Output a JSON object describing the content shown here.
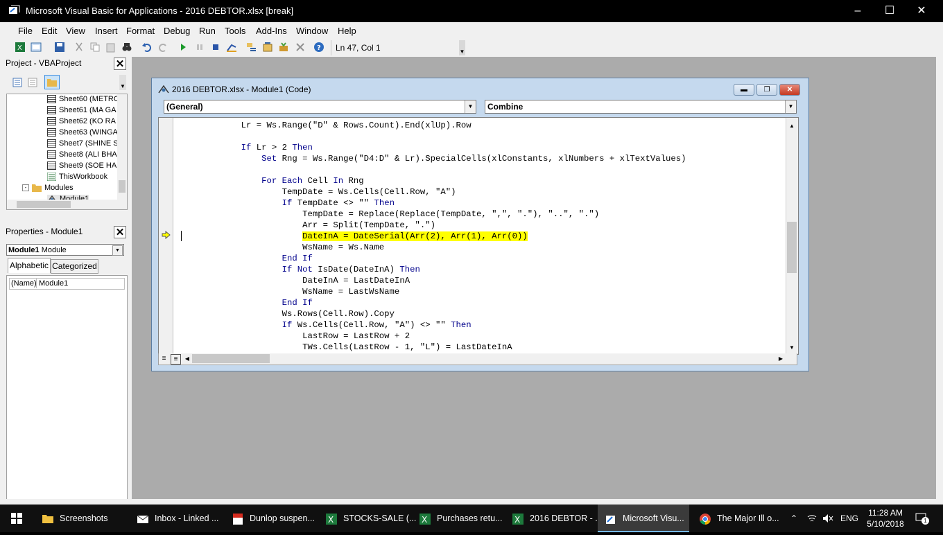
{
  "window": {
    "title": "Microsoft Visual Basic for Applications - 2016 DEBTOR.xlsx [break]"
  },
  "menu": [
    "File",
    "Edit",
    "View",
    "Insert",
    "Format",
    "Debug",
    "Run",
    "Tools",
    "Add-Ins",
    "Window",
    "Help"
  ],
  "toolbar": {
    "position": "Ln 47, Col 1"
  },
  "project": {
    "title": "Project - VBAProject",
    "items": [
      "Sheet60 (METRO",
      "Sheet61 (MA GA",
      "Sheet62 (KO RA",
      "Sheet63 (WINGA",
      "Sheet7 (SHINE S",
      "Sheet8 (ALI BHA",
      "Sheet9 (SOE HA",
      "ThisWorkbook"
    ],
    "modules_folder": "Modules",
    "module": "Module1"
  },
  "properties": {
    "title": "Properties - Module1",
    "object_name": "Module1",
    "object_type": "Module",
    "tab_alpha": "Alphabetic",
    "tab_cat": "Categorized",
    "prop_name": "(Name)",
    "prop_value": "Module1"
  },
  "code_window": {
    "title": "2016 DEBTOR.xlsx - Module1 (Code)",
    "object_combo": "(General)",
    "proc_combo": "Combine"
  },
  "code": [
    {
      "indent": "            ",
      "parts": [
        [
          "",
          "Lr = Ws.Range(\"D\" & Rows.Count).End(xlUp).Row"
        ]
      ]
    },
    {
      "indent": "",
      "parts": []
    },
    {
      "indent": "            ",
      "parts": [
        [
          "kw",
          "If"
        ],
        [
          "",
          " Lr > 2 "
        ],
        [
          "kw",
          "Then"
        ]
      ]
    },
    {
      "indent": "                ",
      "parts": [
        [
          "kw",
          "Set"
        ],
        [
          "",
          " Rng = Ws.Range(\"D4:D\" & Lr).SpecialCells(xlConstants, xlNumbers + xlTextValues)"
        ]
      ]
    },
    {
      "indent": "",
      "parts": []
    },
    {
      "indent": "                ",
      "parts": [
        [
          "kw",
          "For Each"
        ],
        [
          "",
          " Cell "
        ],
        [
          "kw",
          "In"
        ],
        [
          "",
          " Rng"
        ]
      ]
    },
    {
      "indent": "                    ",
      "parts": [
        [
          "",
          "TempDate = Ws.Cells(Cell.Row, \"A\")"
        ]
      ]
    },
    {
      "indent": "                    ",
      "parts": [
        [
          "kw",
          "If"
        ],
        [
          "",
          " TempDate <> \"\" "
        ],
        [
          "kw",
          "Then"
        ]
      ]
    },
    {
      "indent": "                        ",
      "parts": [
        [
          "",
          "TempDate = Replace(Replace(TempDate, \",\", \".\"), \"..\", \".\")"
        ]
      ]
    },
    {
      "indent": "                        ",
      "parts": [
        [
          "",
          "Arr = Split(TempDate, \".\")"
        ]
      ]
    },
    {
      "indent": "                        ",
      "parts": [
        [
          "hl",
          "DateInA = DateSerial(Arr(2), Arr(1), Arr(0))"
        ]
      ]
    },
    {
      "indent": "                        ",
      "parts": [
        [
          "",
          "WsName = Ws.Name"
        ]
      ]
    },
    {
      "indent": "                    ",
      "parts": [
        [
          "kw",
          "End If"
        ]
      ]
    },
    {
      "indent": "                    ",
      "parts": [
        [
          "kw",
          "If Not"
        ],
        [
          "",
          " IsDate(DateInA) "
        ],
        [
          "kw",
          "Then"
        ]
      ]
    },
    {
      "indent": "                        ",
      "parts": [
        [
          "",
          "DateInA = LastDateInA"
        ]
      ]
    },
    {
      "indent": "                        ",
      "parts": [
        [
          "",
          "WsName = LastWsName"
        ]
      ]
    },
    {
      "indent": "                    ",
      "parts": [
        [
          "kw",
          "End If"
        ]
      ]
    },
    {
      "indent": "                    ",
      "parts": [
        [
          "",
          "Ws.Rows(Cell.Row).Copy"
        ]
      ]
    },
    {
      "indent": "                    ",
      "parts": [
        [
          "kw",
          "If"
        ],
        [
          "",
          " Ws.Cells(Cell.Row, \"A\") <> \"\" "
        ],
        [
          "kw",
          "Then"
        ]
      ]
    },
    {
      "indent": "                        ",
      "parts": [
        [
          "",
          "LastRow = LastRow + 2"
        ]
      ]
    },
    {
      "indent": "                        ",
      "parts": [
        [
          "",
          "TWs.Cells(LastRow - 1, \"L\") = LastDateInA"
        ]
      ]
    }
  ],
  "taskbar": {
    "items": [
      "Screenshots",
      "Inbox - Linked ...",
      "Dunlop suspen...",
      "STOCKS-SALE (...",
      "Purchases retu...",
      "2016 DEBTOR - ...",
      "Microsoft Visu...",
      "The Major Ill o..."
    ],
    "lang": "ENG",
    "time": "11:28 AM",
    "date": "5/10/2018",
    "notif_count": "1"
  },
  "colors": {
    "highlight": "#ffff00",
    "keyword": "#00008b",
    "mdi_bg": "#ababab"
  }
}
